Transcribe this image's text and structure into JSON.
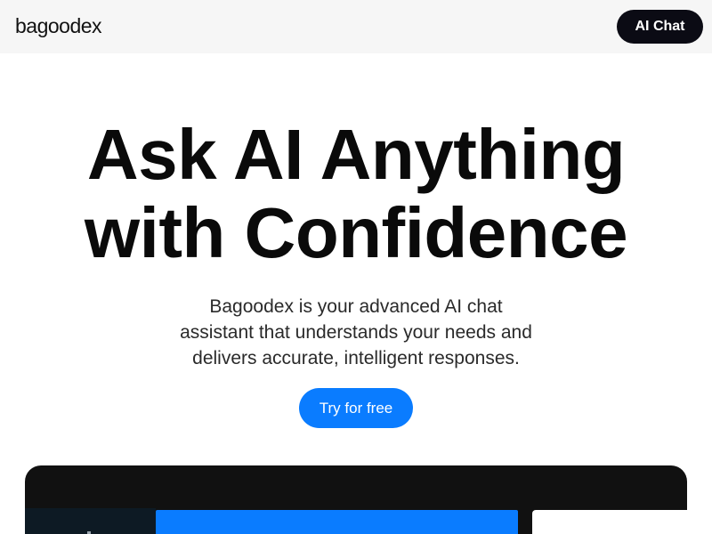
{
  "header": {
    "logo_text": "bagoodex",
    "cta_label": "AI Chat"
  },
  "hero": {
    "title_line1": "Ask AI Anything",
    "title_line2": "with Confidence",
    "subtitle_line1": "Bagoodex is your advanced AI chat",
    "subtitle_line2": "assistant that understands your needs and",
    "subtitle_line3": "delivers accurate, intelligent responses.",
    "cta_label": "Try for free"
  },
  "colors": {
    "header_bg": "#f6f6f6",
    "dark_button": "#0b0b14",
    "accent_blue": "#0a7cff",
    "preview_bg": "#111111"
  }
}
